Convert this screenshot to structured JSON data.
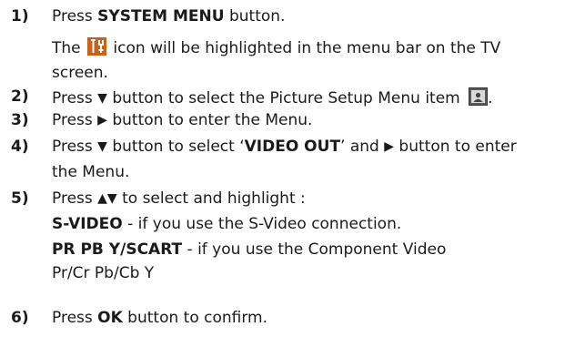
{
  "steps": [
    {
      "num": "1)",
      "lines": [
        {
          "a": "Press ",
          "b": "SYSTEM MENU",
          "c": " button."
        },
        {
          "a": "The ",
          "icon": "tools-icon",
          "c": " icon will be highlighted in the menu bar on the TV"
        },
        {
          "a": "screen."
        }
      ]
    },
    {
      "num": "2)",
      "lines": [
        {
          "a": "Press ",
          "tri": "▼",
          "c": " button to select the Picture Setup Menu item ",
          "icon": "picture-setup-icon",
          "end": "."
        }
      ]
    },
    {
      "num": "3)",
      "lines": [
        {
          "a": "Press ",
          "tri": "▶",
          "c": " button to enter the Menu."
        }
      ]
    },
    {
      "num": "4)",
      "lines": [
        {
          "a": "Press ",
          "tri": "▼",
          "c": " button to select ‘",
          "b": "VIDEO OUT",
          "d": "’ and ",
          "tri2": "▶",
          "e": " button to enter"
        },
        {
          "a": "the Menu."
        }
      ]
    },
    {
      "num": "5)",
      "lines": [
        {
          "a": "Press ",
          "tri": "▲▼",
          "c": " to select and highlight :"
        },
        {
          "b": "S-VIDEO",
          "c": " - if you use the S-Video connection."
        },
        {
          "b": "PR PB Y/SCART",
          "c": " - if you use the Component Video"
        },
        {
          "a": "Pr/Cr Pb/Cb Y"
        }
      ]
    },
    {
      "num": "6)",
      "lines": [
        {
          "a": "Press ",
          "b": "OK",
          "c": " button to confirm."
        }
      ]
    }
  ]
}
